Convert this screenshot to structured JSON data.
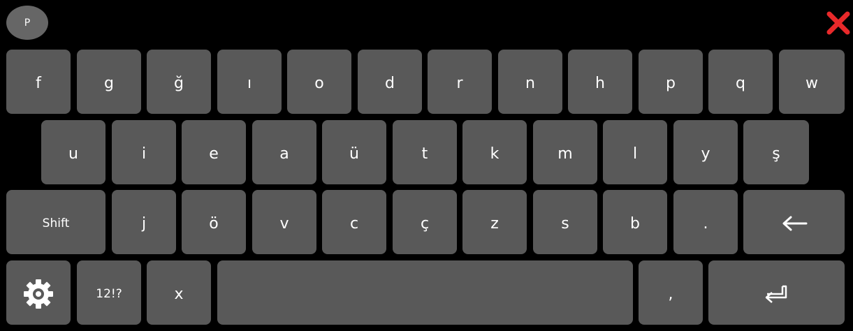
{
  "top": {
    "badge": "P"
  },
  "rows": [
    [
      "f",
      "g",
      "ğ",
      "ı",
      "o",
      "d",
      "r",
      "n",
      "h",
      "p",
      "q",
      "w"
    ],
    [
      "u",
      "i",
      "e",
      "a",
      "ü",
      "t",
      "k",
      "m",
      "l",
      "y",
      "ş"
    ],
    [
      "Shift",
      "j",
      "ö",
      "v",
      "c",
      "ç",
      "z",
      "s",
      "b",
      "."
    ]
  ],
  "bottom": {
    "numbers": "12!?",
    "x": "x",
    "comma": ","
  },
  "icons": {
    "close": "close-x-icon",
    "backspace": "arrow-left-icon",
    "settings": "gear-icon",
    "enter": "enter-return-icon"
  },
  "colors": {
    "background": "#000000",
    "key": "#595959",
    "text": "#ffffff",
    "close": "#e8292a"
  }
}
